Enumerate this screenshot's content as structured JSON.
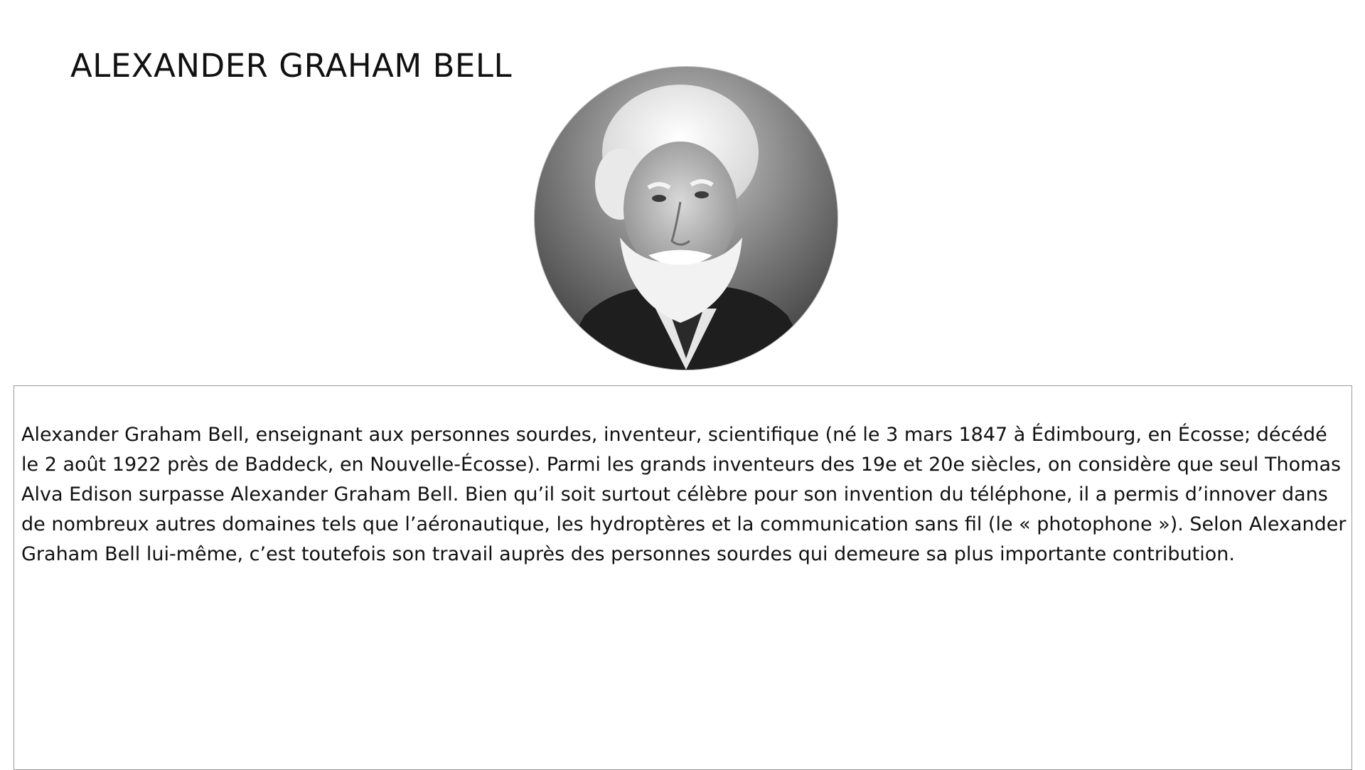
{
  "title": "ALEXANDER GRAHAM BELL",
  "portrait": {
    "icon": "portrait-photo-grayscale",
    "shape": "circle"
  },
  "bio": {
    "text": "Alexander Graham Bell, enseignant aux personnes sourdes, inventeur, scientifique (né le 3 mars 1847 à Édimbourg, en Écosse; décédé le 2 août 1922 près de Baddeck, en Nouvelle-Écosse). Parmi les grands inventeurs des 19e et 20e siècles, on considère que seul Thomas Alva Edison surpasse Alexander Graham Bell. Bien qu’il soit surtout célèbre pour son invention du téléphone, il a permis d’innover dans de nombreux autres domaines tels que l’aéronautique, les hydroptères et la communication sans fil (le « photophone »). Selon Alexander Graham Bell lui-même, c’est toutefois son travail auprès des personnes sourdes qui demeure sa plus importante contribution."
  }
}
